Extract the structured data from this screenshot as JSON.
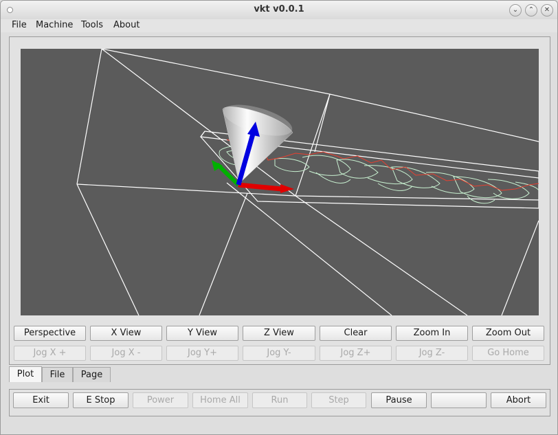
{
  "window": {
    "title": "vkt v0.0.1"
  },
  "menubar": {
    "items": [
      "File",
      "Machine",
      "Tools",
      "About"
    ]
  },
  "view_buttons": [
    "Perspective",
    "X View",
    "Y View",
    "Z View",
    "Clear",
    "Zoom In",
    "Zoom Out"
  ],
  "jog_buttons": [
    "Jog X +",
    "Jog X -",
    "Jog Y+",
    "Jog Y-",
    "Jog Z+",
    "Jog Z-",
    "Go Home"
  ],
  "tabs": [
    {
      "label": "Plot",
      "active": true
    },
    {
      "label": "File",
      "active": false
    },
    {
      "label": "Page",
      "active": false
    }
  ],
  "control_buttons": [
    {
      "label": "Exit",
      "enabled": true
    },
    {
      "label": "E Stop",
      "enabled": true
    },
    {
      "label": "Power",
      "enabled": false
    },
    {
      "label": "Home All",
      "enabled": false
    },
    {
      "label": "Run",
      "enabled": false
    },
    {
      "label": "Step",
      "enabled": false
    },
    {
      "label": "Pause",
      "enabled": true
    },
    {
      "label": "",
      "enabled": true
    },
    {
      "label": "Abort",
      "enabled": true
    }
  ],
  "colors": {
    "viewport_bg": "#5b5b5b",
    "wire": "#ffffff",
    "toolpath": "#c8f0d0",
    "path_red": "#e84030",
    "axis_x": "#e00000",
    "axis_y": "#00b000",
    "axis_z": "#0000e0"
  }
}
